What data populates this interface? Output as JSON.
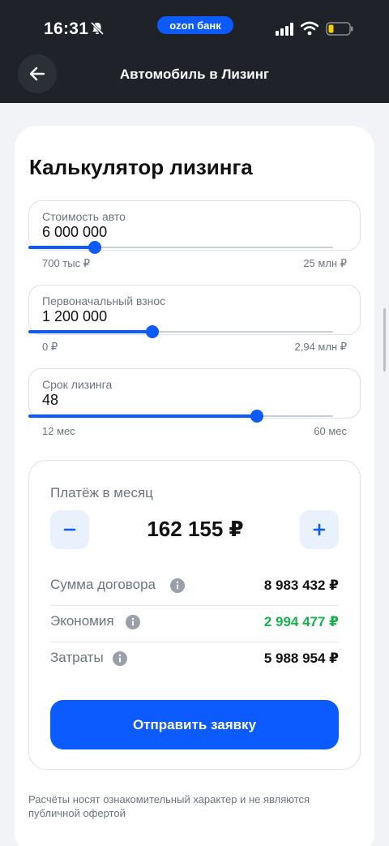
{
  "status_bar": {
    "time": "16:31",
    "brand": "ozon банк"
  },
  "header": {
    "title": "Автомобиль в Лизинг"
  },
  "calculator": {
    "title": "Калькулятор лизинга",
    "fields": [
      {
        "label": "Стоимость авто",
        "value": "6 000 000",
        "min_label": "700 тыс ₽",
        "max_label": "25 млн ₽",
        "fraction": 0.218
      },
      {
        "label": "Первоначальный взнос",
        "value": "1 200 000",
        "min_label": "0 ₽",
        "max_label": "2,94 млн ₽",
        "fraction": 0.408
      },
      {
        "label": "Срок лизинга",
        "value": "48",
        "min_label": "12 мес",
        "max_label": "60 мес",
        "fraction": 0.75
      }
    ]
  },
  "payment": {
    "label": "Платёж в месяц",
    "amount": "162 155 ₽",
    "minus_label": "−",
    "plus_label": "+",
    "rows": [
      {
        "label": "Сумма договора",
        "value": "8 983 432 ₽"
      },
      {
        "label": "Экономия",
        "value": "2 994 477 ₽"
      },
      {
        "label": "Затраты",
        "value": "5 988 954 ₽"
      }
    ],
    "submit_label": "Отправить заявку"
  },
  "disclaimer": "Расчёты носят ознакомительный характер и не являются публичной офертой",
  "colors": {
    "accent": "#0b5bff",
    "economy": "#17b34a",
    "header_bg": "#1f2228"
  }
}
